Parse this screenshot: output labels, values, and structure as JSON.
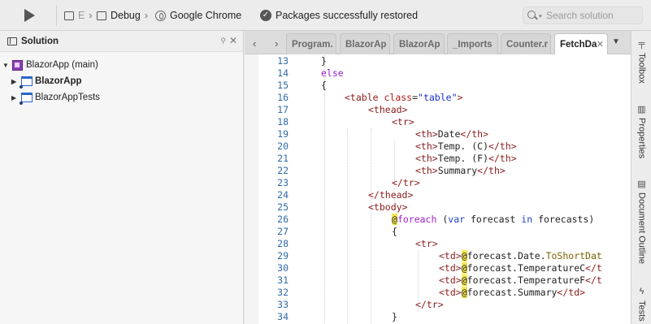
{
  "toolbar": {
    "config_partial": "E",
    "config_mode": "Debug",
    "target": "Google Chrome",
    "status": "Packages successfully restored",
    "search_placeholder": "Search solution"
  },
  "solution": {
    "title": "Solution",
    "items": [
      {
        "label": "BlazorApp (main)",
        "kind": "solution"
      },
      {
        "label": "BlazorApp",
        "kind": "project"
      },
      {
        "label": "BlazorAppTests",
        "kind": "project"
      }
    ]
  },
  "tabs": [
    {
      "label": "Program."
    },
    {
      "label": "BlazorAp"
    },
    {
      "label": "BlazorAp"
    },
    {
      "label": "_Imports"
    },
    {
      "label": "Counter.r"
    },
    {
      "label": "FetchDa",
      "active": true
    }
  ],
  "code": {
    "lines": [
      {
        "n": "13"
      },
      {
        "n": "14"
      },
      {
        "n": "15"
      },
      {
        "n": "16"
      },
      {
        "n": "17"
      },
      {
        "n": "18"
      },
      {
        "n": "19"
      },
      {
        "n": "20"
      },
      {
        "n": "21"
      },
      {
        "n": "22"
      },
      {
        "n": "23"
      },
      {
        "n": "24"
      },
      {
        "n": "25"
      },
      {
        "n": "26"
      },
      {
        "n": "27"
      },
      {
        "n": "28"
      },
      {
        "n": "29"
      },
      {
        "n": "30"
      },
      {
        "n": "31"
      },
      {
        "n": "32"
      },
      {
        "n": "33"
      },
      {
        "n": "34"
      }
    ],
    "text": {
      "l13": "}",
      "l14": "else",
      "l15": "{",
      "l16_a": "<table ",
      "l16_b": "class",
      "l16_c": "=",
      "l16_d": "\"table\"",
      "l16_e": ">",
      "l17": "<thead>",
      "l18": "<tr>",
      "l19_a": "<th>",
      "l19_b": "Date",
      "l19_c": "</th>",
      "l20_a": "<th>",
      "l20_b": "Temp. (C)",
      "l20_c": "</th>",
      "l21_a": "<th>",
      "l21_b": "Temp. (F)",
      "l21_c": "</th>",
      "l22_a": "<th>",
      "l22_b": "Summary",
      "l22_c": "</th>",
      "l23": "</tr>",
      "l24": "</thead>",
      "l25": "<tbody>",
      "l26_a": "@",
      "l26_b": "foreach",
      "l26_c": " (",
      "l26_d": "var",
      "l26_e": " forecast ",
      "l26_f": "in",
      "l26_g": " forecasts)",
      "l27": "{",
      "l28": "<tr>",
      "l29_a": "<td>",
      "l29_b": "@",
      "l29_c": "forecast.Date.",
      "l29_d": "ToShortDat",
      "l30_a": "<td>",
      "l30_b": "@",
      "l30_c": "forecast.TemperatureC",
      "l30_d": "</t",
      "l31_a": "<td>",
      "l31_b": "@",
      "l31_c": "forecast.TemperatureF",
      "l31_d": "</t",
      "l32_a": "<td>",
      "l32_b": "@",
      "l32_c": "forecast.Summary",
      "l32_d": "</td>",
      "l33": "</tr>",
      "l34": "}"
    }
  },
  "dock": {
    "toolbox": "Toolbox",
    "properties": "Properties",
    "outline": "Document Outline",
    "tests": "Tests"
  }
}
